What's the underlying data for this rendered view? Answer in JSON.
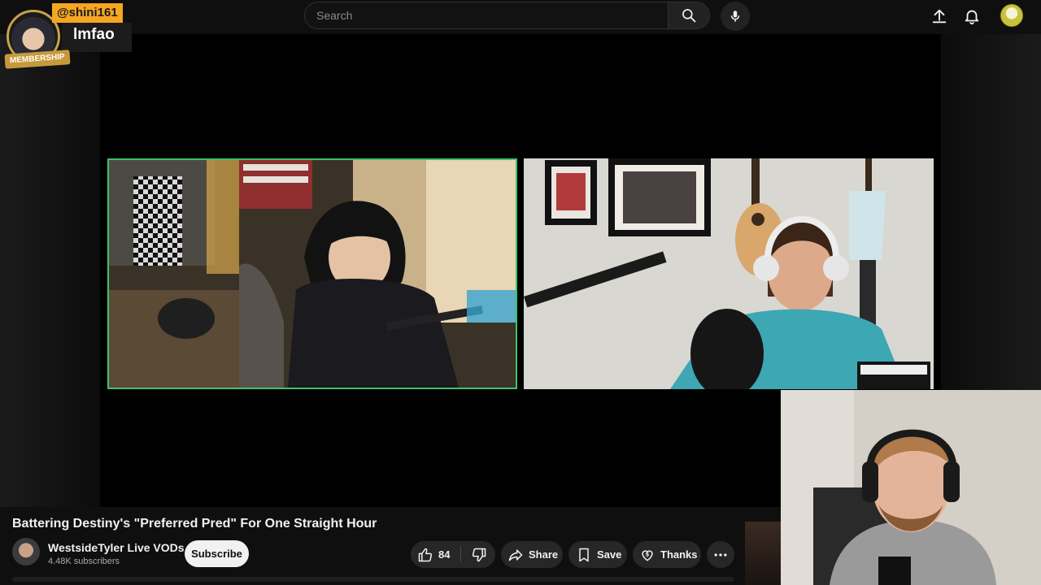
{
  "search": {
    "placeholder": "Search"
  },
  "icons": {
    "search": "search-icon",
    "mic": "mic-icon",
    "upload": "upload-icon",
    "notifications": "bell-icon",
    "like": "thumbs-up-icon",
    "dislike": "thumbs-down-icon",
    "share": "share-arrow-icon",
    "save": "bookmark-icon",
    "thanks": "thanks-heart-icon",
    "more": "more-horizontal-icon"
  },
  "superchat": {
    "handle": "@shini161",
    "message": "lmfao",
    "badge": "MEMBERSHIP"
  },
  "video": {
    "title": "Battering Destiny's \"Preferred Pred\" For One Straight Hour"
  },
  "channel": {
    "name": "WestsideTyler Live VODs",
    "subscribers": "4.48K subscribers"
  },
  "actions": {
    "subscribe": "Subscribe",
    "like_count": "84",
    "share": "Share",
    "save": "Save",
    "thanks": "Thanks"
  },
  "colors": {
    "background": "#0f0f0f",
    "pill": "#272727",
    "subscribe_bg": "#f1f1f1",
    "superchat_handle_bg": "#f6a623",
    "active_cam_border": "#3fc26d",
    "membership_badge": "#c69a3b"
  }
}
